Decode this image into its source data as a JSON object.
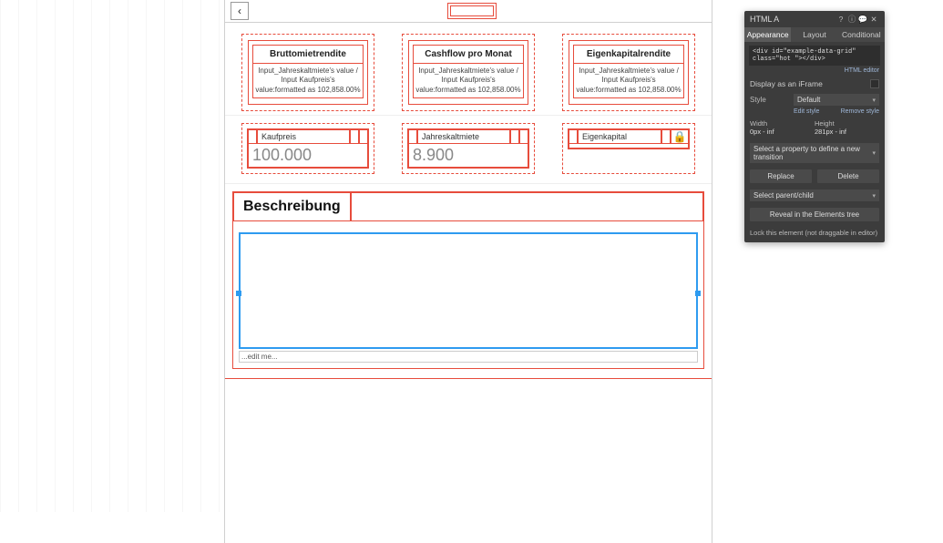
{
  "canvas": {
    "topbar": {
      "back_glyph": "‹"
    },
    "cards": [
      {
        "title": "Bruttomietrendite",
        "body": "Input_Jahreskaltmiete's value / Input Kaufpreis's value:formatted as 102,858.00%"
      },
      {
        "title": "Cashflow pro Monat",
        "body": "Input_Jahreskaltmiete's value / Input Kaufpreis's value:formatted as 102,858.00%"
      },
      {
        "title": "Eigenkapitalrendite",
        "body": "Input_Jahreskaltmiete's value / Input Kaufpreis's value:formatted as 102,858.00%"
      }
    ],
    "inputs": [
      {
        "label": "Kaufpreis",
        "value": "100.000",
        "locked": false
      },
      {
        "label": "Jahreskaltmiete",
        "value": "8.900",
        "locked": false
      },
      {
        "label": "Eigenkapital",
        "value": "",
        "locked": true
      }
    ],
    "description": {
      "title": "Beschreibung",
      "edit_placeholder": "...edit me..."
    }
  },
  "inspector": {
    "title": "HTML A",
    "tabs": {
      "appearance": "Appearance",
      "layout": "Layout",
      "conditional": "Conditional"
    },
    "code": "<div id=\"example-data-grid\" class=\"hot \"></div>",
    "html_editor_link": "HTML editor",
    "iframe": {
      "label": "Display as an iFrame"
    },
    "style": {
      "label": "Style",
      "value": "Default",
      "edit": "Edit style",
      "remove": "Remove style"
    },
    "dims": {
      "width_label": "Width",
      "width_value": "0px - inf",
      "height_label": "Height",
      "height_value": "281px - inf"
    },
    "transition_select": "Select a property to define a new transition",
    "buttons": {
      "replace": "Replace",
      "delete": "Delete"
    },
    "parent_select": "Select parent/child",
    "reveal": "Reveal in the Elements tree",
    "lock_label": "Lock this element (not draggable in editor)"
  }
}
